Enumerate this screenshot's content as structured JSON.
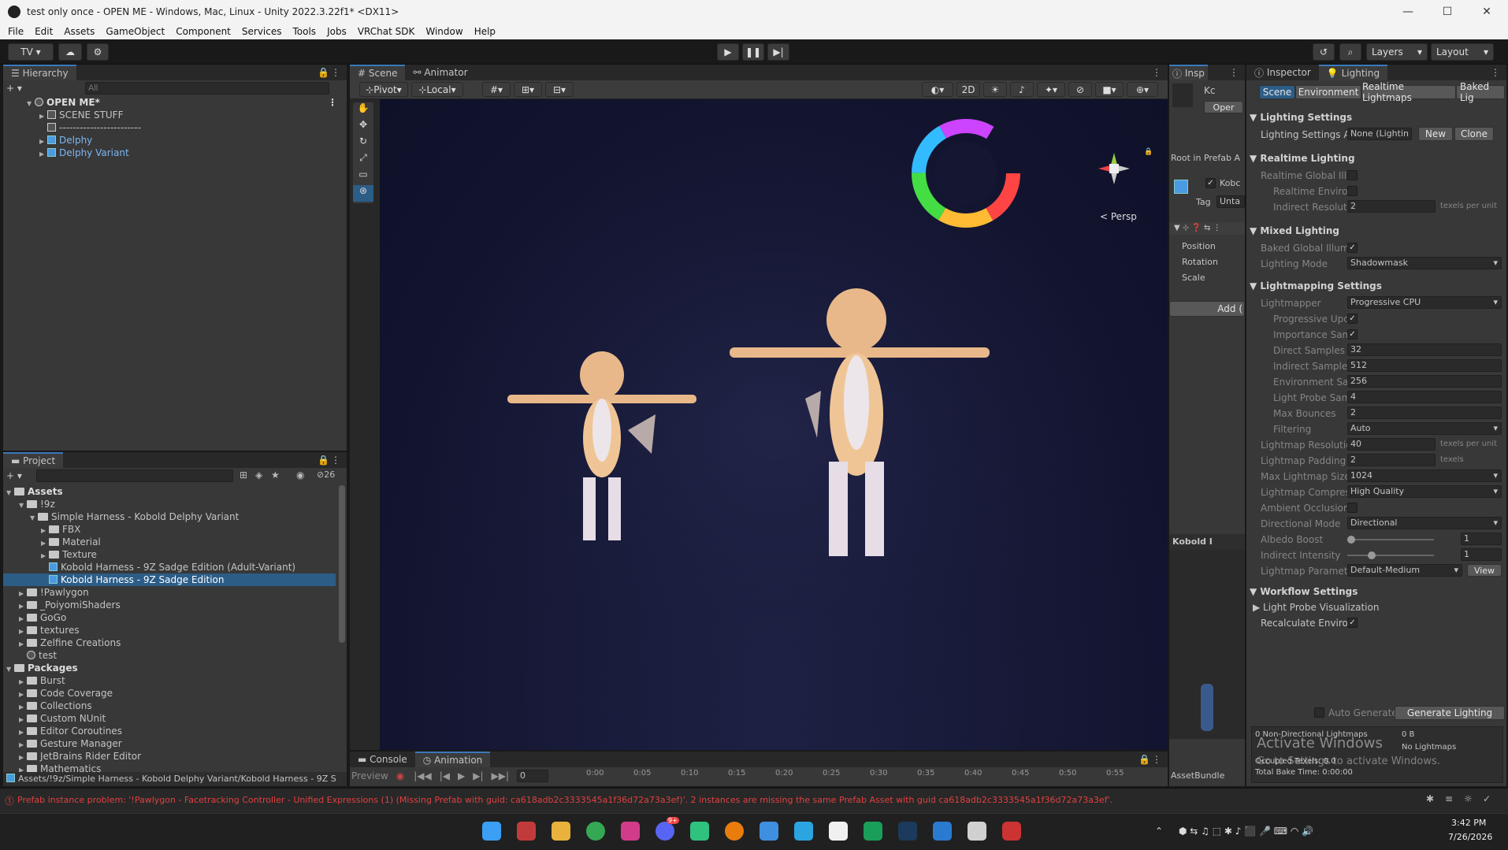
{
  "window": {
    "title": "test only once - OPEN ME - Windows, Mac, Linux - Unity 2022.3.22f1* <DX11>",
    "minimize": "—",
    "maximize": "☐",
    "close": "✕"
  },
  "menu": [
    "File",
    "Edit",
    "Assets",
    "GameObject",
    "Component",
    "Services",
    "Tools",
    "Jobs",
    "VRChat SDK",
    "Window",
    "Help"
  ],
  "toolbar": {
    "account": "TV ▾",
    "layers": "Layers",
    "layout": "Layout"
  },
  "hierarchy": {
    "tab": "Hierarchy",
    "search_placeholder": "All",
    "scene": "OPEN ME*",
    "items": [
      {
        "label": "SCENE STUFF"
      },
      {
        "label": "------------------------"
      },
      {
        "label": "Delphy"
      },
      {
        "label": "Delphy Variant"
      }
    ]
  },
  "project": {
    "tab": "Project",
    "hidden_count": "26",
    "assets_root": "Assets",
    "items": [
      {
        "label": "!9z"
      },
      {
        "label": "Simple Harness - Kobold Delphy Variant"
      },
      {
        "label": "FBX"
      },
      {
        "label": "Material"
      },
      {
        "label": "Texture"
      },
      {
        "label": "Kobold Harness - 9Z Sadge Edition (Adult-Variant)"
      },
      {
        "label": "Kobold Harness - 9Z Sadge Edition"
      },
      {
        "label": "!Pawlygon"
      },
      {
        "label": "_PoiyomiShaders"
      },
      {
        "label": "GoGo"
      },
      {
        "label": "textures"
      },
      {
        "label": "Zelfine Creations"
      },
      {
        "label": "test"
      }
    ],
    "packages_root": "Packages",
    "packages": [
      "Burst",
      "Code Coverage",
      "Collections",
      "Custom NUnit",
      "Editor Coroutines",
      "Gesture Manager",
      "JetBrains Rider Editor",
      "Mathematics"
    ],
    "path": "Assets/!9z/Simple Harness - Kobold Delphy Variant/Kobold Harness - 9Z S"
  },
  "scene": {
    "tabs": [
      "Scene",
      "Animator"
    ],
    "pivot": "Pivot",
    "local": "Local",
    "mode_2d": "2D",
    "persp": "Persp"
  },
  "bottom": {
    "tabs": [
      "Console",
      "Animation"
    ],
    "preview": "Preview",
    "frame": "0",
    "timeline": [
      "0:00",
      "0:05",
      "0:10",
      "0:15",
      "0:20",
      "0:25",
      "0:30",
      "0:35",
      "0:40",
      "0:45",
      "0:50",
      "0:55"
    ]
  },
  "inspector_small": {
    "tab": "Insp",
    "name": "Kc",
    "open": "Oper",
    "root": "Root in Prefab A",
    "obj_name": "Kobc",
    "tag_label": "Tag",
    "tag_value": "Unta",
    "position": "Position",
    "rotation": "Rotation",
    "scale": "Scale",
    "add": "Add (",
    "preview_name": "Kobold I",
    "asset_bundle": "AssetBundle"
  },
  "lighting": {
    "tabs": [
      "Inspector",
      "Lighting"
    ],
    "subtabs": [
      "Scene",
      "Environment",
      "Realtime Lightmaps",
      "Baked Lig"
    ],
    "lighting_settings_header": "Lighting Settings",
    "settings_asset_label": "Lighting Settings A",
    "settings_asset_value": "None (Lightin",
    "new": "New",
    "clone": "Clone",
    "realtime_header": "Realtime Lighting",
    "realtime_gi": "Realtime Global Illu",
    "realtime_env": "Realtime Enviro",
    "indirect_res_label": "Indirect Resoluti",
    "indirect_res_value": "2",
    "texels_per_unit": "texels per unit",
    "mixed_header": "Mixed Lighting",
    "baked_gi": "Baked Global Illum",
    "lighting_mode_label": "Lighting Mode",
    "lighting_mode_value": "Shadowmask",
    "lightmapping_header": "Lightmapping Settings",
    "lightmapper_label": "Lightmapper",
    "lightmapper_value": "Progressive CPU",
    "progressive_updates": "Progressive Upc",
    "importance_sampling": "Importance Sam",
    "direct_samples_label": "Direct Samples",
    "direct_samples_value": "32",
    "indirect_samples_label": "Indirect Samples",
    "indirect_samples_value": "512",
    "env_samples_label": "Environment Sa",
    "env_samples_value": "256",
    "light_probe_label": "Light Probe Sam",
    "light_probe_value": "4",
    "max_bounces_label": "Max Bounces",
    "max_bounces_value": "2",
    "filtering_label": "Filtering",
    "filtering_value": "Auto",
    "lightmap_res_label": "Lightmap Resolutic",
    "lightmap_res_value": "40",
    "lightmap_pad_label": "Lightmap Padding",
    "lightmap_pad_value": "2",
    "texels": "texels",
    "max_size_label": "Max Lightmap Size",
    "max_size_value": "1024",
    "compression_label": "Lightmap Compres",
    "compression_value": "High Quality",
    "ao_label": "Ambient Occlusion",
    "directional_label": "Directional Mode",
    "directional_value": "Directional",
    "albedo_label": "Albedo Boost",
    "albedo_value": "1",
    "indirect_int_label": "Indirect Intensity",
    "indirect_int_value": "1",
    "params_label": "Lightmap Paramet",
    "params_value": "Default-Medium",
    "view": "View",
    "workflow_header": "Workflow Settings",
    "probe_vis": "Light Probe Visualization",
    "recalc": "Recalculate Enviro",
    "auto_generate": "Auto Generate",
    "generate": "Generate Lighting",
    "stats_1": "0 Non-Directional Lightmaps",
    "stats_1b": "0 B",
    "stats_1c": "No Lightmaps",
    "stats_2": "Occupied Texels: 0.0",
    "stats_3": "Total Bake Time: 0:00:00",
    "watermark_1": "Activate Windows",
    "watermark_2": "Go to Settings to activate Windows."
  },
  "status": {
    "message": "Prefab instance problem: '!Pawlygon - Facetracking Controller - Unified Expressions (1) (Missing Prefab with guid: ca618adb2c3333545a1f36d72a73a3ef)'. 2 instances are missing the same Prefab Asset with guid ca618adb2c3333545a1f36d72a73a3ef'."
  },
  "taskbar": {
    "time": "3:42 PM",
    "date": "7/26/2026",
    "discord_badge": "9+"
  },
  "colors": {
    "selection": "#2c5d87",
    "accent": "#3a79bb",
    "error": "#e04040"
  }
}
